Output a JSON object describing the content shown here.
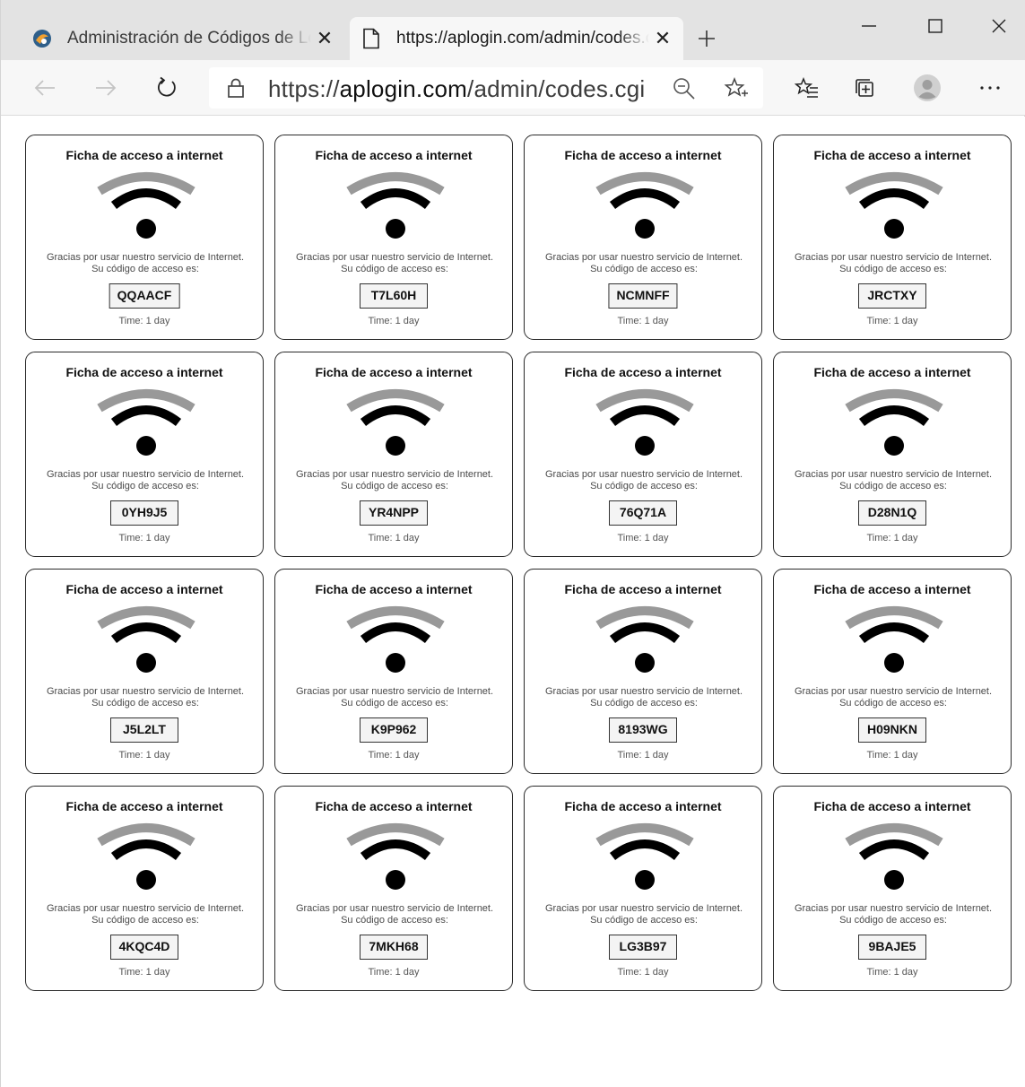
{
  "browser": {
    "tabs": [
      {
        "title": "Administración de Códigos de Lo",
        "favicon": "site-logo-icon",
        "active": false
      },
      {
        "title": "https://aplogin.com/admin/codes.cgi",
        "favicon": "page-icon",
        "active": true
      }
    ],
    "address": {
      "scheme": "https://",
      "host": "aplogin.com",
      "path": "/admin/codes.cgi"
    }
  },
  "tickets": [
    {
      "title": "Ficha de acceso a internet",
      "message": "Gracias por usar nuestro servicio de Internet. Su código de acceso es:",
      "code": "QQAACF",
      "time": "Time: 1 day"
    },
    {
      "title": "Ficha de acceso a internet",
      "message": "Gracias por usar nuestro servicio de Internet. Su código de acceso es:",
      "code": "T7L60H",
      "time": "Time: 1 day"
    },
    {
      "title": "Ficha de acceso a internet",
      "message": "Gracias por usar nuestro servicio de Internet. Su código de acceso es:",
      "code": "NCMNFF",
      "time": "Time: 1 day"
    },
    {
      "title": "Ficha de acceso a internet",
      "message": "Gracias por usar nuestro servicio de Internet. Su código de acceso es:",
      "code": "JRCTXY",
      "time": "Time: 1 day"
    },
    {
      "title": "Ficha de acceso a internet",
      "message": "Gracias por usar nuestro servicio de Internet. Su código de acceso es:",
      "code": "0YH9J5",
      "time": "Time: 1 day"
    },
    {
      "title": "Ficha de acceso a internet",
      "message": "Gracias por usar nuestro servicio de Internet. Su código de acceso es:",
      "code": "YR4NPP",
      "time": "Time: 1 day"
    },
    {
      "title": "Ficha de acceso a internet",
      "message": "Gracias por usar nuestro servicio de Internet. Su código de acceso es:",
      "code": "76Q71A",
      "time": "Time: 1 day"
    },
    {
      "title": "Ficha de acceso a internet",
      "message": "Gracias por usar nuestro servicio de Internet. Su código de acceso es:",
      "code": "D28N1Q",
      "time": "Time: 1 day"
    },
    {
      "title": "Ficha de acceso a internet",
      "message": "Gracias por usar nuestro servicio de Internet. Su código de acceso es:",
      "code": "J5L2LT",
      "time": "Time: 1 day"
    },
    {
      "title": "Ficha de acceso a internet",
      "message": "Gracias por usar nuestro servicio de Internet. Su código de acceso es:",
      "code": "K9P962",
      "time": "Time: 1 day"
    },
    {
      "title": "Ficha de acceso a internet",
      "message": "Gracias por usar nuestro servicio de Internet. Su código de acceso es:",
      "code": "8193WG",
      "time": "Time: 1 day"
    },
    {
      "title": "Ficha de acceso a internet",
      "message": "Gracias por usar nuestro servicio de Internet. Su código de acceso es:",
      "code": "H09NKN",
      "time": "Time: 1 day"
    },
    {
      "title": "Ficha de acceso a internet",
      "message": "Gracias por usar nuestro servicio de Internet. Su código de acceso es:",
      "code": "4KQC4D",
      "time": "Time: 1 day"
    },
    {
      "title": "Ficha de acceso a internet",
      "message": "Gracias por usar nuestro servicio de Internet. Su código de acceso es:",
      "code": "7MKH68",
      "time": "Time: 1 day"
    },
    {
      "title": "Ficha de acceso a internet",
      "message": "Gracias por usar nuestro servicio de Internet. Su código de acceso es:",
      "code": "LG3B97",
      "time": "Time: 1 day"
    },
    {
      "title": "Ficha de acceso a internet",
      "message": "Gracias por usar nuestro servicio de Internet. Su código de acceso es:",
      "code": "9BAJE5",
      "time": "Time: 1 day"
    }
  ],
  "colors": {
    "wifi_outer": "#999999",
    "wifi_inner": "#000000",
    "tabstrip_bg": "#e3e3e3",
    "toolbar_bg": "#f7f7f7"
  }
}
